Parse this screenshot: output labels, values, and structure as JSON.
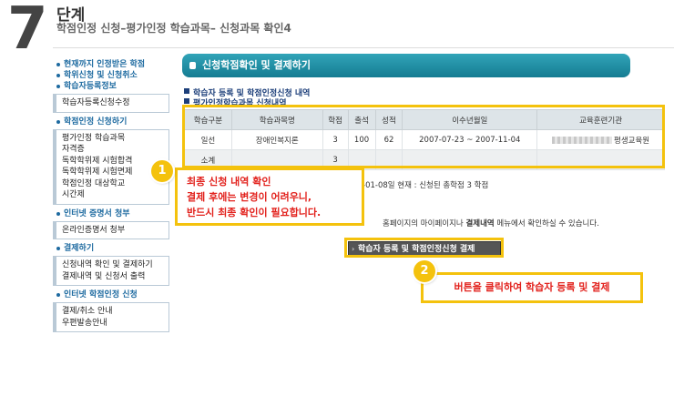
{
  "header": {
    "step_number": "7",
    "step_word": "단계",
    "path": "학점인정 신청–평가인정 학습과목– 신청과목 확인4"
  },
  "sidebar": {
    "top_links": [
      "현재까지 인정받은 학점",
      "학위신청 및 신청취소",
      "학습자등록정보"
    ],
    "groups": [
      {
        "header": null,
        "items": [
          "학습자등록신청수정"
        ]
      },
      {
        "header": "학점인정 신청하기",
        "items": [
          "평가인정 학습과목",
          "자격증",
          "독학학위제 시험합격",
          "독학학위제 시험면제",
          "학점인정 대상학교",
          "시간제"
        ]
      },
      {
        "header": "인터넷 증명서 청부",
        "items": [
          "온라인증명서 청부"
        ]
      },
      {
        "header": "결제하기",
        "items": [
          "신청내역 확인 및 결제하기",
          "결제내역 및 신청서 출력"
        ]
      },
      {
        "header": "인터넷 학점인정 신청",
        "items": [
          "결제/취소 안내",
          "우편발송안내"
        ]
      }
    ]
  },
  "main": {
    "title": "신청학점확인 및 결제하기",
    "section1": "학습자 등록 및 학점인정신청 내역",
    "section2": "평가인정학습과목 신청내역",
    "table": {
      "headers": [
        "학습구분",
        "학습과목명",
        "학점",
        "출석",
        "성적",
        "이수년월일",
        "교육훈련기관"
      ],
      "row": [
        "일선",
        "장애인복지론",
        "3",
        "100",
        "62",
        "2007-07-23 ~ 2007-11-04",
        "평생교육원"
      ],
      "subtotal_label": "소계",
      "subtotal_credit": "3"
    },
    "date_info": "-01-08일 현재 : 신청된 총학점  3 학점",
    "page_info_pre": "홈페이지의 마이페이지나 ",
    "page_info_bold": "결제내역",
    "page_info_post": " 메뉴에서 확인하실 수 있습니다.",
    "pay_button": "학습자 등록 및 학점인정신청 결제"
  },
  "callouts": {
    "one_badge": "1",
    "one_line1": "최종 신청 내역 확인",
    "one_line2": "결제 후에는 변경이 어려우니,",
    "one_line3": "반드시 최종 확인이 필요합니다.",
    "two_badge": "2",
    "two_text": "버튼을 클릭하여 학습자 등록 및 결제"
  }
}
